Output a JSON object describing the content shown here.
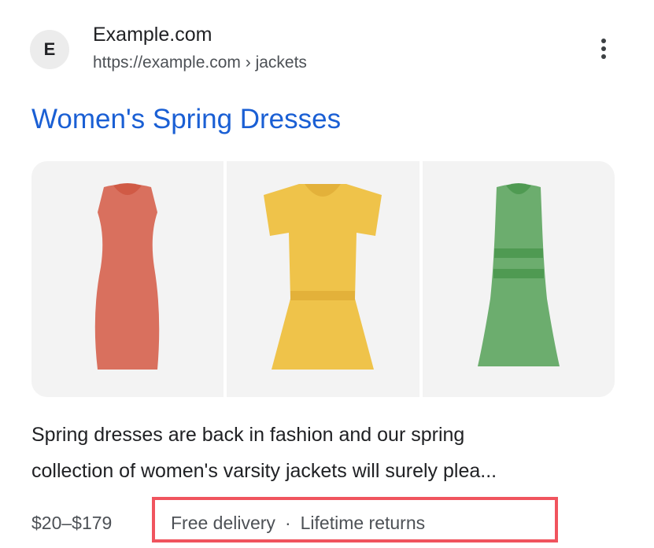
{
  "result": {
    "favicon_letter": "E",
    "site_name": "Example.com",
    "site_url": "https://example.com › jackets",
    "more_icon": "more-vert-icon",
    "title": "Women's Spring Dresses",
    "images": [
      {
        "name": "red-dress-image",
        "color": "#d9705e",
        "accent": "#d05a45"
      },
      {
        "name": "yellow-dress-image",
        "color": "#efc34a",
        "accent": "#e3b13a"
      },
      {
        "name": "green-dress-image",
        "color": "#6cad6e",
        "accent": "#4f9a52"
      }
    ],
    "snippet_line1": "Spring dresses are back in fashion and our spring",
    "snippet_line2": "collection of women's varsity jackets will surely plea...",
    "price": "$20–$179",
    "feature1": "Free delivery",
    "separator": "·",
    "feature2": "Lifetime returns",
    "highlight_color": "#f0545e",
    "title_color": "#1a5fd4"
  }
}
